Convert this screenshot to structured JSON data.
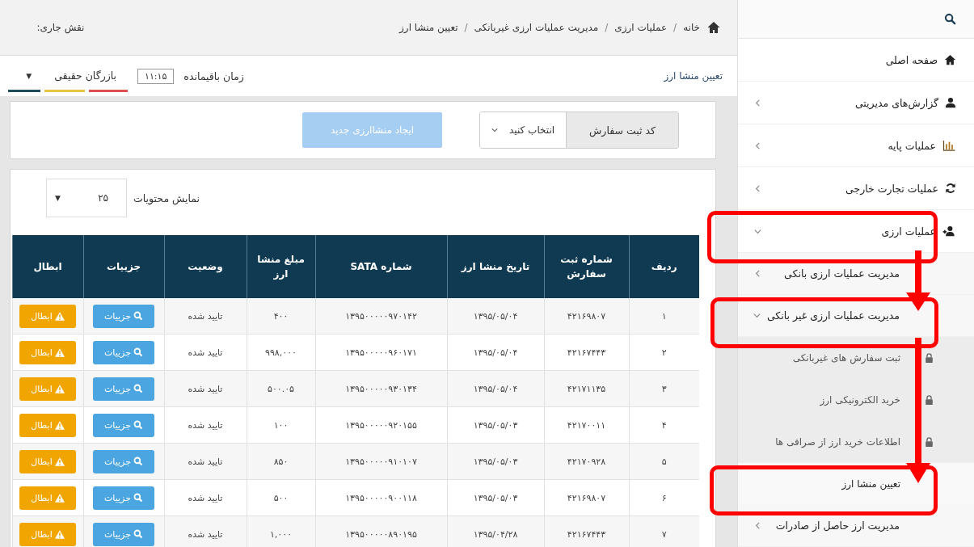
{
  "breadcrumb": [
    "خانه",
    "عملیات ارزی",
    "مدیریت عملیات ارزی غیربانکی",
    "تعیین منشا ارز"
  ],
  "breadcrumb_separator": "/",
  "current_role_label": "نقش جاری:",
  "page_title": "تعیین منشا ارز",
  "timer": {
    "label": "زمان باقیمانده",
    "value": "۱۱:۱۵"
  },
  "role_select": {
    "value": "بازرگان حقیقی",
    "caret": "▼"
  },
  "toolbar": {
    "field_label": "کد ثبت سفارش",
    "select": {
      "placeholder": "انتخاب کنید"
    },
    "create_button": {
      "label": "ایجاد منشاارزی جدید",
      "disabled": true
    }
  },
  "page_size": {
    "label": "نمایش محتویات",
    "value": "۲۵",
    "caret": "▼"
  },
  "table": {
    "columns": [
      "ردیف",
      "شماره ثبت سفارش",
      "تاریخ منشا ارز",
      "شماره SATA",
      "مبلغ منشا ارز",
      "وضعیت",
      "جزییات",
      "ابطال"
    ],
    "rows": [
      {
        "cells": [
          "۱",
          "۴۲۱۶۹۸۰۷",
          "۱۳۹۵/۰۵/۰۴",
          "۱۳۹۵۰۰۰۰۰۹۷۰۱۴۲",
          "۴۰۰",
          "تایید شده"
        ],
        "details": "جزییات",
        "cancel": "ابطال"
      },
      {
        "cells": [
          "۲",
          "۴۲۱۶۷۴۴۳",
          "۱۳۹۵/۰۵/۰۴",
          "۱۳۹۵۰۰۰۰۰۹۶۰۱۷۱",
          "۹۹۸,۰۰۰",
          "تایید شده"
        ],
        "details": "جزییات",
        "cancel": "ابطال"
      },
      {
        "cells": [
          "۳",
          "۴۲۱۷۱۱۳۵",
          "۱۳۹۵/۰۵/۰۴",
          "۱۳۹۵۰۰۰۰۰۹۳۰۱۳۴",
          "۵۰۰.۰۵",
          "تایید شده"
        ],
        "details": "جزییات",
        "cancel": "ابطال"
      },
      {
        "cells": [
          "۴",
          "۴۲۱۷۰۰۱۱",
          "۱۳۹۵/۰۵/۰۳",
          "۱۳۹۵۰۰۰۰۰۹۲۰۱۵۵",
          "۱۰۰",
          "تایید شده"
        ],
        "details": "جزییات",
        "cancel": "ابطال"
      },
      {
        "cells": [
          "۵",
          "۴۲۱۷۰۹۲۸",
          "۱۳۹۵/۰۵/۰۳",
          "۱۳۹۵۰۰۰۰۰۹۱۰۱۰۷",
          "۸۵۰",
          "تایید شده"
        ],
        "details": "جزییات",
        "cancel": "ابطال"
      },
      {
        "cells": [
          "۶",
          "۴۲۱۶۹۸۰۷",
          "۱۳۹۵/۰۵/۰۳",
          "۱۳۹۵۰۰۰۰۰۹۰۰۱۱۸",
          "۵۰۰",
          "تایید شده"
        ],
        "details": "جزییات",
        "cancel": "ابطال"
      },
      {
        "cells": [
          "۷",
          "۴۲۱۶۷۴۴۳",
          "۱۳۹۵/۰۴/۲۸",
          "۱۳۹۵۰۰۰۰۰۸۹۰۱۹۵",
          "۱,۰۰۰",
          "تایید شده"
        ],
        "details": "جزییات",
        "cancel": "ابطال"
      }
    ]
  },
  "sidebar": {
    "items": [
      {
        "label": "صفحه اصلی",
        "kind": "link"
      },
      {
        "label": "گزارش‌های مدیریتی",
        "kind": "menu",
        "expanded": false
      },
      {
        "label": "عملیات پایه",
        "kind": "menu",
        "expanded": false
      },
      {
        "label": "عملیات تجارت خارجی",
        "kind": "menu",
        "expanded": false
      },
      {
        "label": "عملیات ارزی",
        "kind": "menu",
        "expanded": true,
        "children": [
          {
            "label": "مدیریت عملیات ارزی بانکی",
            "expanded": false
          },
          {
            "label": "مدیریت عملیات ارزی غیر بانکی",
            "expanded": true,
            "children": [
              {
                "label": "ثبت سفارش های غیربانکی",
                "locked": true,
                "selected": false
              },
              {
                "label": "خرید الکترونیکی ارز",
                "locked": true,
                "selected": false
              },
              {
                "label": "اطلاعات خرید ارز از صرافی ها",
                "locked": true,
                "selected": false
              },
              {
                "label": "تعیین منشا ارز",
                "locked": false,
                "selected": true
              }
            ]
          },
          {
            "label": "مدیریت ارز حاصل از صادرات",
            "expanded": false
          }
        ]
      }
    ]
  }
}
